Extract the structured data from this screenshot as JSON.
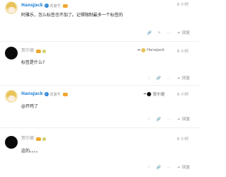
{
  "posts": [
    {
      "author": "HansJack",
      "author_tag": "凯撒号",
      "time": "6 小时",
      "text": "阿雅乐，怎么标签也不加了。记得限制最多一个标签的",
      "reply_to": "",
      "actions": {
        "reply_label": "回复"
      }
    },
    {
      "author": "贺尔德",
      "author_tag": "",
      "time": "6 小时",
      "text": "标签是什么?",
      "reply_to": "HansJack",
      "actions": {
        "reply_label": "回复"
      }
    },
    {
      "author": "HansJack",
      "author_tag": "凯撒号",
      "time": "6 小时",
      "text": "@",
      "mention": "开鸡了",
      "reply_to": "贺尔德",
      "actions": {
        "reply_label": "回复"
      }
    },
    {
      "author": "贺尔德",
      "author_tag": "",
      "time": "6 小时",
      "text": "这的。。。。",
      "reply_to": "",
      "actions": {
        "reply_label": "回复"
      }
    }
  ],
  "icons": {
    "verified": "verified-icon",
    "crown": "crown-badge-icon",
    "like": "heart-icon",
    "link": "link-icon",
    "edit": "pencil-icon",
    "more": "more-icon",
    "reply": "reply-arrow-icon"
  },
  "colors": {
    "accent": "#2a86d8",
    "muted": "#9a9a9a"
  }
}
